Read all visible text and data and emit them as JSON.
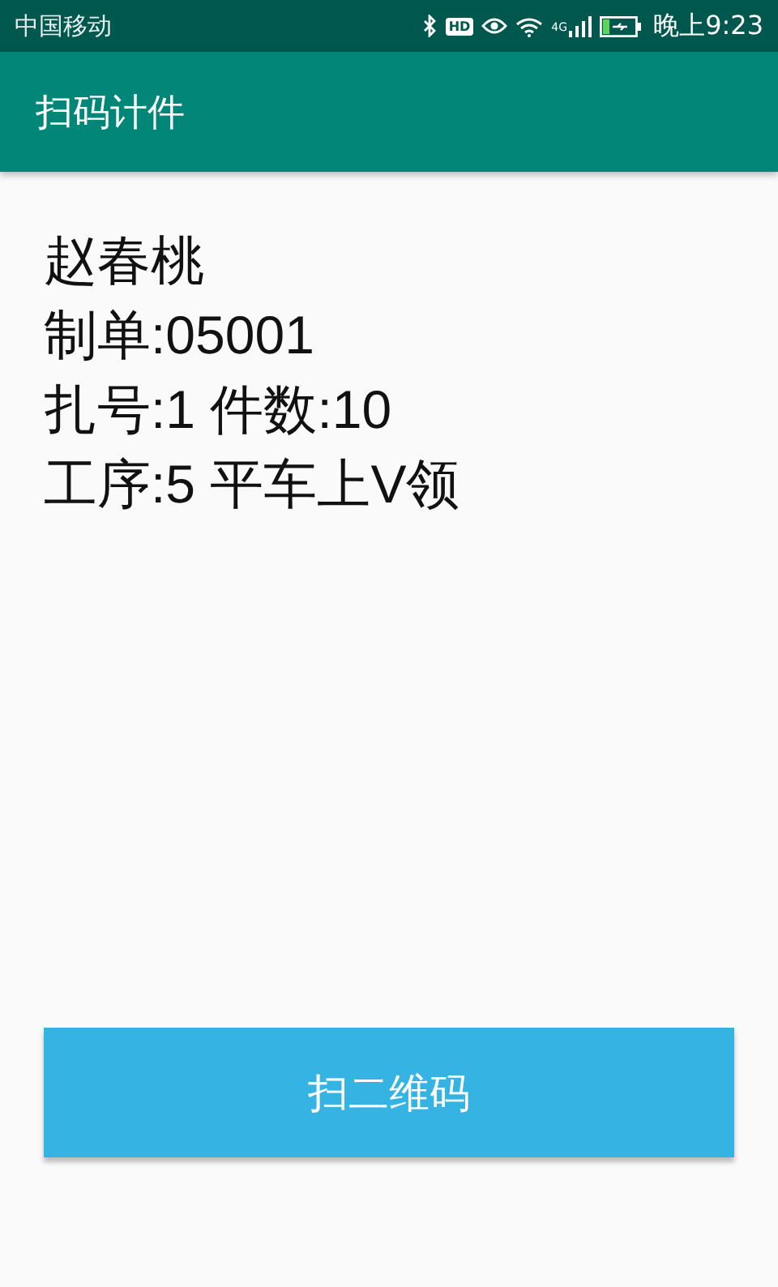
{
  "status_bar": {
    "carrier": "中国移动",
    "hd_badge": "HD",
    "network": "4G",
    "time": "晚上9:23"
  },
  "app_bar": {
    "title": "扫码计件"
  },
  "info_lines": [
    "赵春桃",
    "制单:05001",
    "扎号:1 件数:10",
    "工序:5 平车上V领"
  ],
  "scan_button": {
    "label": "扫二维码"
  }
}
